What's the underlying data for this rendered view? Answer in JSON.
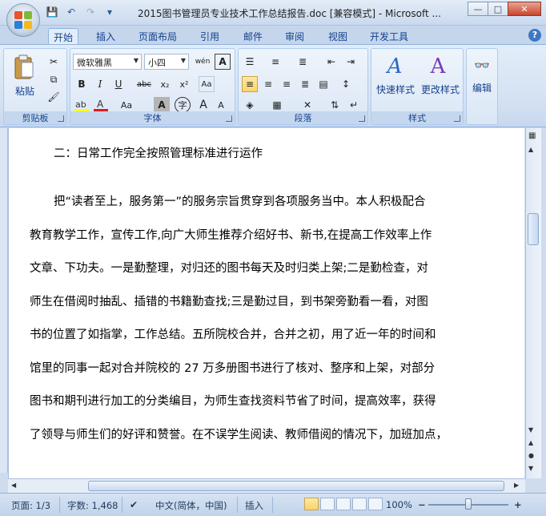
{
  "window": {
    "title": "2015图书管理员专业技术工作总结报告.doc [兼容模式] - Microsoft ...",
    "controls": {
      "minimize": "—",
      "maximize": "□",
      "close": "✕"
    }
  },
  "quick_access": {
    "save_icon": "💾",
    "undo_icon": "↶",
    "redo_icon": "↷",
    "customize_icon": "▾"
  },
  "tabs": [
    "开始",
    "插入",
    "页面布局",
    "引用",
    "邮件",
    "审阅",
    "视图",
    "开发工具"
  ],
  "help_label": "?",
  "ribbon": {
    "clipboard": {
      "paste_label": "粘贴",
      "group_label": "剪贴板"
    },
    "font": {
      "font_name": "微软雅黑",
      "font_size": "小四",
      "group_label": "字体",
      "buttons": {
        "bold": "B",
        "italic": "I",
        "underline": "U",
        "strike": "abc",
        "subscript": "x₂",
        "superscript": "x²",
        "change_case": "Aa",
        "grow": "A",
        "shrink": "A",
        "clear": "Aa",
        "char_border": "A",
        "phonetic": "wén",
        "encircle": "字"
      }
    },
    "paragraph": {
      "group_label": "段落"
    },
    "styles": {
      "quick_styles_label": "快速样式",
      "change_styles_label": "更改样式",
      "group_label": "样式"
    },
    "editing": {
      "label": "编辑"
    }
  },
  "document": {
    "lines": [
      "二：日常工作完全按照管理标准进行运作",
      "把“读者至上，服务第一”的服务宗旨贯穿到各项服务当中。本人积极配合",
      "教育教学工作，宣传工作,向广大师生推荐介绍好书、新书,在提高工作效率上作",
      "文章、下功夫。一是勤整理，对归还的图书每天及时归类上架;二是勤检查，对",
      "师生在借阅时抽乱、插错的书籍勤查找;三是勤过目，到书架旁勤看一看，对图",
      "书的位置了如指掌，工作总结。五所院校合并，合并之初，用了近一年的时间和",
      "馆里的同事一起对合并院校的 27 万多册图书进行了核对、整序和上架，对部分",
      "图书和期刊进行加工的分类编目，为师生查找资料节省了时间，提高效率，获得",
      "了领导与师生们的好评和赞誉。在不误学生阅读、教师借阅的情况下，加班加点，"
    ]
  },
  "status": {
    "page": "页面: 1/3",
    "words": "字数: 1,468",
    "language": "中文(简体，中国)",
    "mode": "插入",
    "zoom": "100%",
    "zoom_minus": "−",
    "zoom_plus": "+"
  }
}
